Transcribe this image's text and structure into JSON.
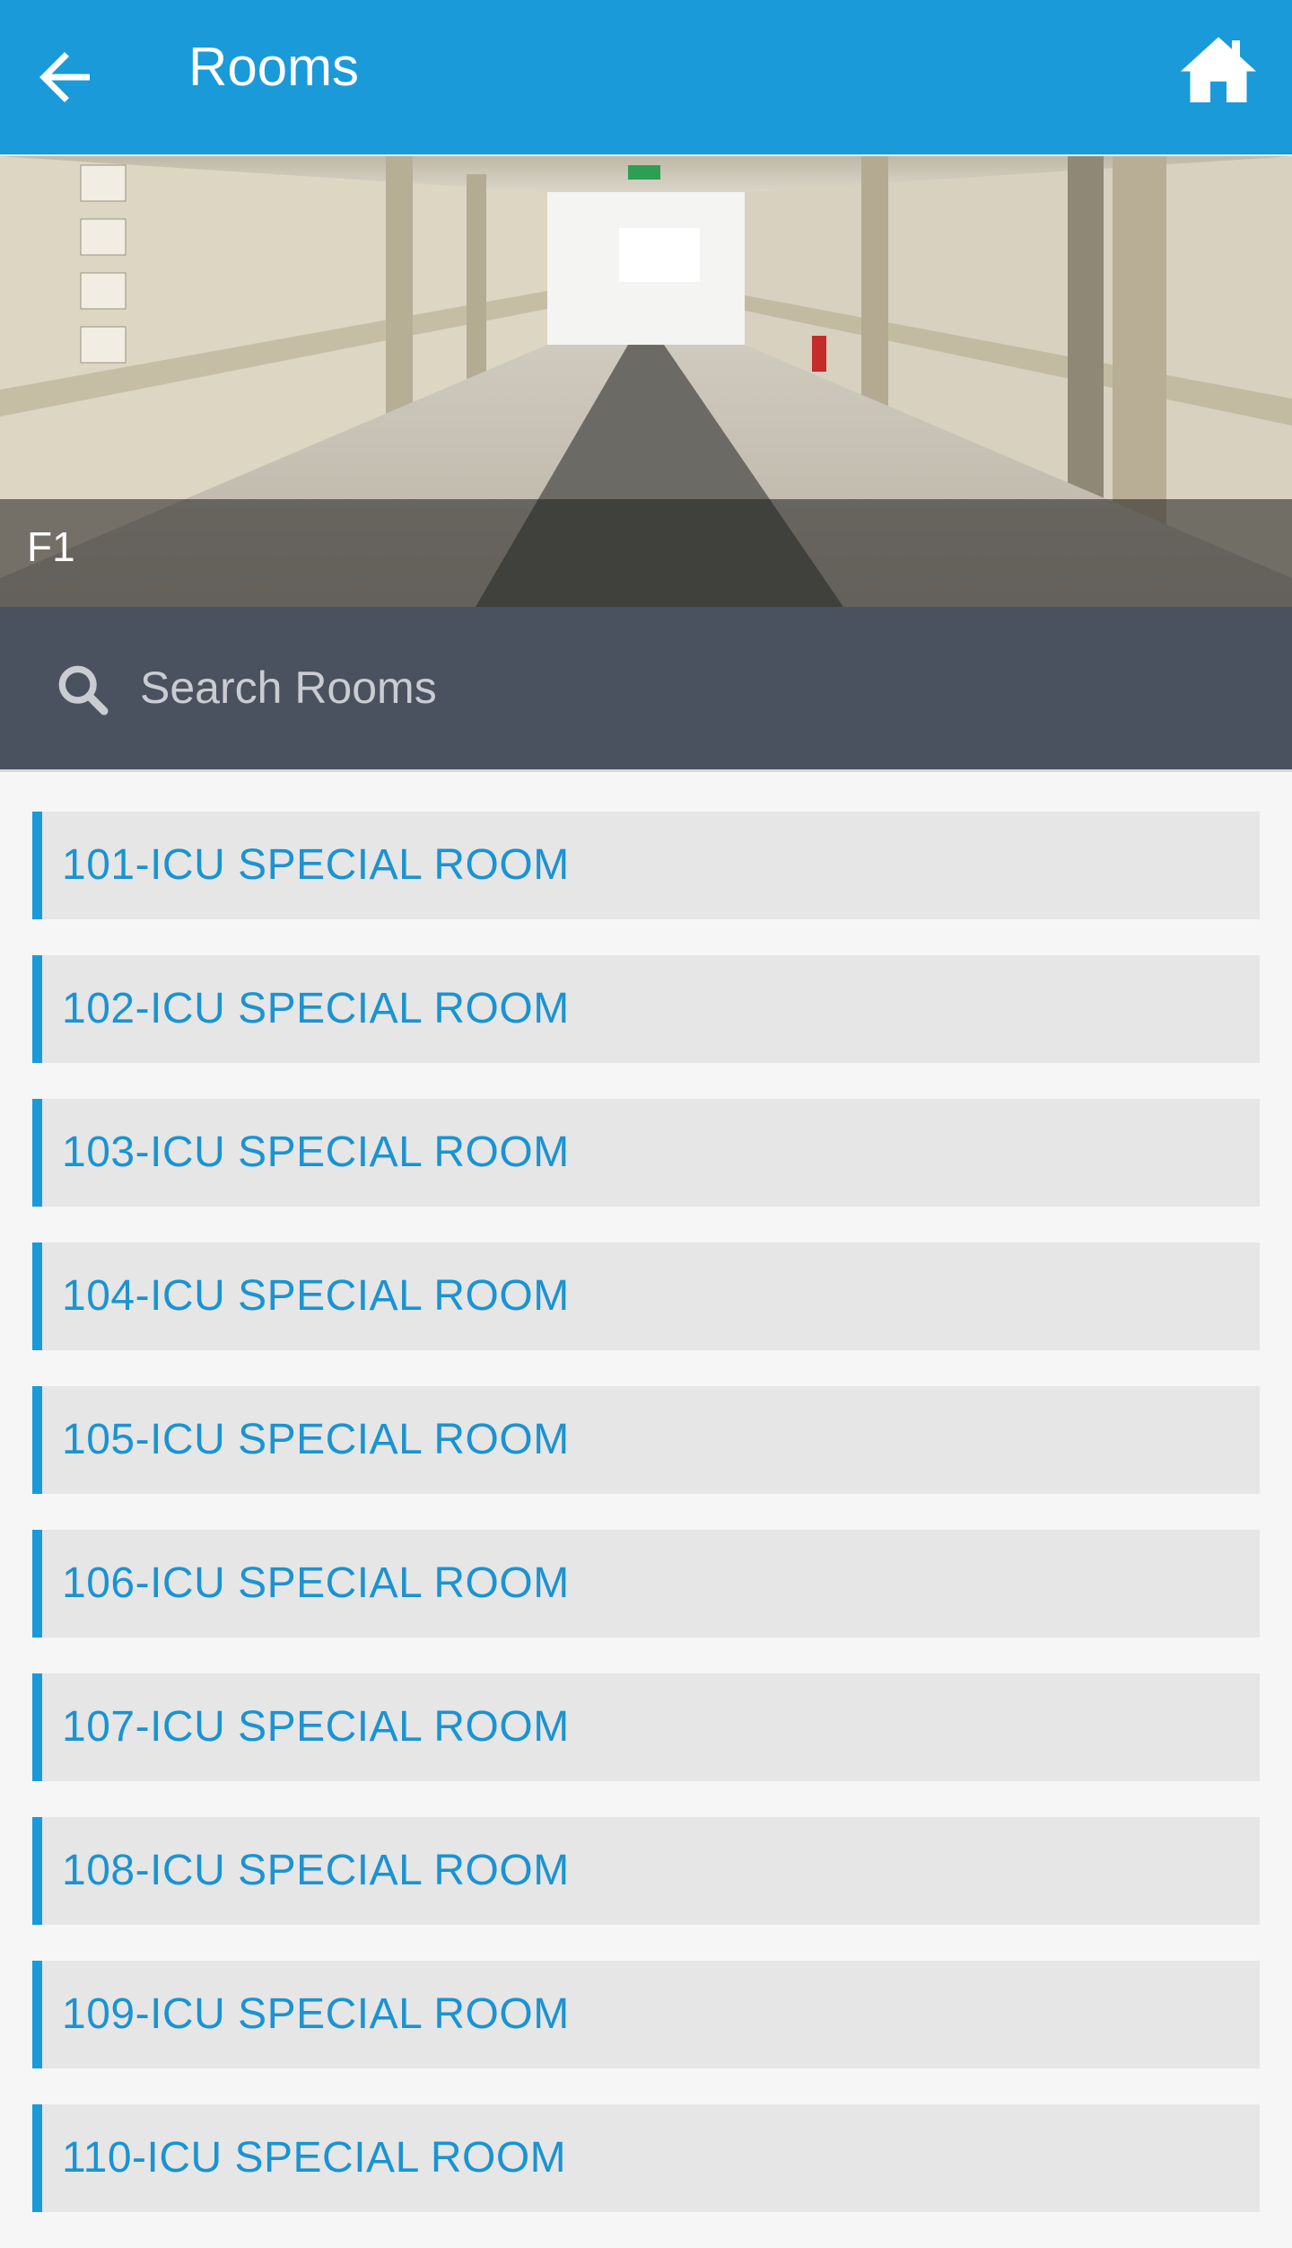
{
  "appbar": {
    "title": "Rooms",
    "back_icon": "arrow-left-icon",
    "home_icon": "home-icon",
    "color": "#1a9ad9"
  },
  "banner": {
    "floor_label": "F1"
  },
  "search": {
    "placeholder": "Search Rooms",
    "value": "",
    "icon": "search-icon"
  },
  "rooms": [
    {
      "label": "101-ICU SPECIAL ROOM"
    },
    {
      "label": "102-ICU SPECIAL ROOM"
    },
    {
      "label": "103-ICU SPECIAL ROOM"
    },
    {
      "label": "104-ICU SPECIAL ROOM"
    },
    {
      "label": "105-ICU SPECIAL ROOM"
    },
    {
      "label": "106-ICU SPECIAL ROOM"
    },
    {
      "label": "107-ICU SPECIAL ROOM"
    },
    {
      "label": "108-ICU SPECIAL ROOM"
    },
    {
      "label": "109-ICU SPECIAL ROOM"
    },
    {
      "label": "110-ICU SPECIAL ROOM"
    }
  ]
}
